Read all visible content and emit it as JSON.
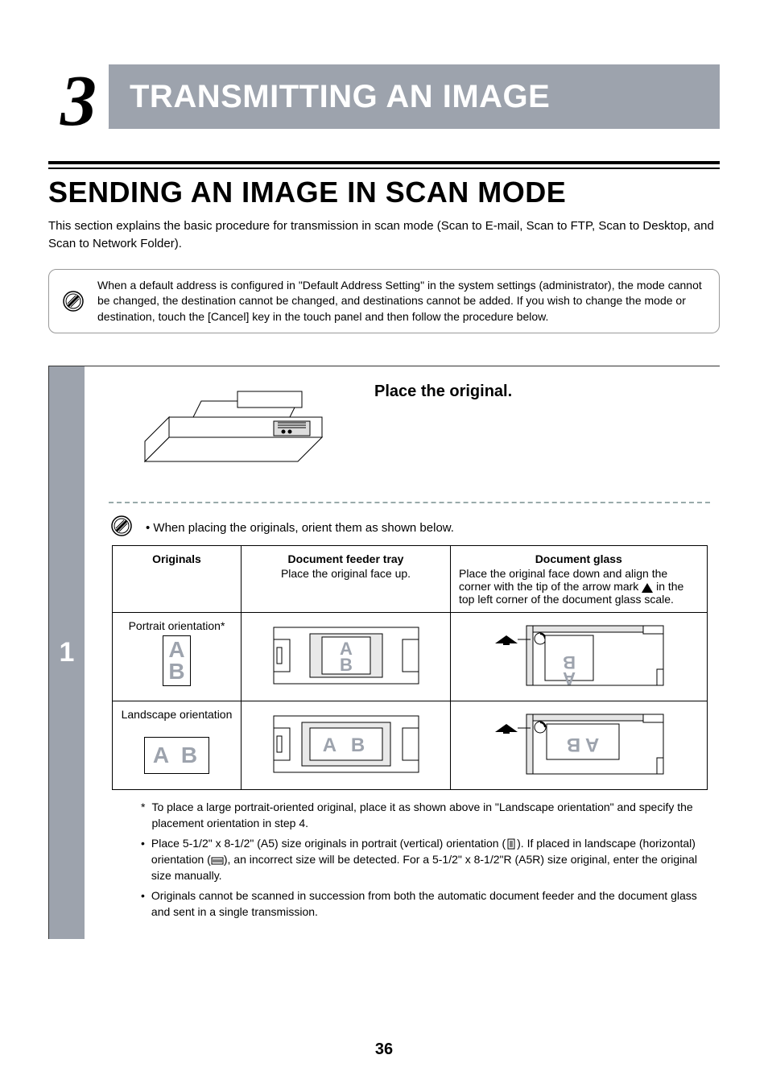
{
  "chapter": {
    "number": "3",
    "title": "TRANSMITTING AN IMAGE"
  },
  "section": {
    "title": "SENDING AN IMAGE IN SCAN MODE",
    "intro": "This section explains the basic procedure for transmission in scan mode (Scan to E-mail, Scan to FTP, Scan to Desktop, and Scan to Network Folder)."
  },
  "top_note": "When a default address is configured in \"Default Address Setting\" in the system settings (administrator), the mode cannot be changed, the destination cannot be changed, and destinations cannot be added. If you wish to change the mode or destination, touch the [Cancel] key in the touch panel and then follow the procedure below.",
  "step": {
    "number": "1",
    "instruction": "Place the original.",
    "bullet": "When placing the originals, orient them as shown below."
  },
  "table": {
    "originals_header": "Originals",
    "feeder_header": "Document feeder tray",
    "feeder_sub": "Place the original face up.",
    "glass_header": "Document glass",
    "glass_sub_a": "Place the original face down and align the corner with the tip of the arrow mark ",
    "glass_sub_b": " in the top left corner of the document glass scale.",
    "row1_label": "Portrait orientation*",
    "row2_label": "Landscape orientation",
    "ab_a": "A",
    "ab_b": "B",
    "ab_row": "A B"
  },
  "footnotes": {
    "star": "To place a large portrait-oriented original, place it as shown above in \"Landscape orientation\" and specify the placement orientation in step 4.",
    "b1a": "Place 5-1/2\" x 8-1/2\" (A5) size originals in portrait (vertical) orientation (",
    "b1b": "). If placed in landscape (horizontal) orientation (",
    "b1c": "), an incorrect size will be detected. For a 5-1/2\" x 8-1/2\"R (A5R) size original, enter the original size manually.",
    "b2": "Originals cannot be scanned in succession from both the automatic document feeder and the document glass and sent in a single transmission."
  },
  "page_number": "36"
}
